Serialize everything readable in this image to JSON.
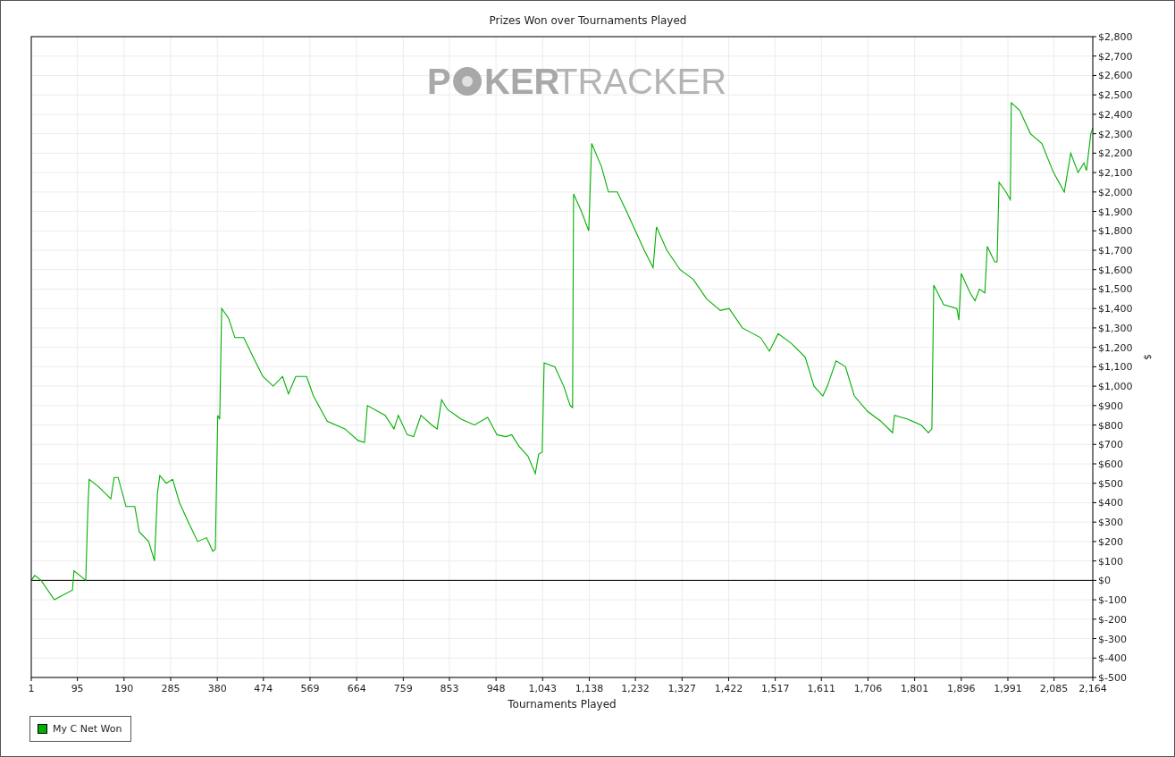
{
  "chart": {
    "watermark": {
      "lead": "P",
      "middle": "KER",
      "tail": "TRACKER"
    },
    "chart_data": {
      "type": "line",
      "grid": true,
      "title": "Prizes Won over Tournaments Played",
      "xlabel": "Tournaments Played",
      "ylabel": "$",
      "xlim": [
        1,
        2164
      ],
      "ylim": [
        -500,
        2800
      ],
      "xticks": [
        {
          "value": 1,
          "label": "1"
        },
        {
          "value": 95,
          "label": "95"
        },
        {
          "value": 190,
          "label": "190"
        },
        {
          "value": 285,
          "label": "285"
        },
        {
          "value": 380,
          "label": "380"
        },
        {
          "value": 474,
          "label": "474"
        },
        {
          "value": 569,
          "label": "569"
        },
        {
          "value": 664,
          "label": "664"
        },
        {
          "value": 759,
          "label": "759"
        },
        {
          "value": 853,
          "label": "853"
        },
        {
          "value": 948,
          "label": "948"
        },
        {
          "value": 1043,
          "label": "1,043"
        },
        {
          "value": 1138,
          "label": "1,138"
        },
        {
          "value": 1232,
          "label": "1,232"
        },
        {
          "value": 1327,
          "label": "1,327"
        },
        {
          "value": 1422,
          "label": "1,422"
        },
        {
          "value": 1517,
          "label": "1,517"
        },
        {
          "value": 1611,
          "label": "1,611"
        },
        {
          "value": 1706,
          "label": "1,706"
        },
        {
          "value": 1801,
          "label": "1,801"
        },
        {
          "value": 1896,
          "label": "1,896"
        },
        {
          "value": 1991,
          "label": "1,991"
        },
        {
          "value": 2085,
          "label": "2,085"
        },
        {
          "value": 2164,
          "label": "2,164"
        }
      ],
      "yticks": [
        {
          "value": 2800,
          "label": "$2,800"
        },
        {
          "value": 2700,
          "label": "$2,700"
        },
        {
          "value": 2600,
          "label": "$2,600"
        },
        {
          "value": 2500,
          "label": "$2,500"
        },
        {
          "value": 2400,
          "label": "$2,400"
        },
        {
          "value": 2300,
          "label": "$2,300"
        },
        {
          "value": 2200,
          "label": "$2,200"
        },
        {
          "value": 2100,
          "label": "$2,100"
        },
        {
          "value": 2000,
          "label": "$2,000"
        },
        {
          "value": 1900,
          "label": "$1,900"
        },
        {
          "value": 1800,
          "label": "$1,800"
        },
        {
          "value": 1700,
          "label": "$1,700"
        },
        {
          "value": 1600,
          "label": "$1,600"
        },
        {
          "value": 1500,
          "label": "$1,500"
        },
        {
          "value": 1400,
          "label": "$1,400"
        },
        {
          "value": 1300,
          "label": "$1,300"
        },
        {
          "value": 1200,
          "label": "$1,200"
        },
        {
          "value": 1100,
          "label": "$1,100"
        },
        {
          "value": 1000,
          "label": "$1,000"
        },
        {
          "value": 900,
          "label": "$900"
        },
        {
          "value": 800,
          "label": "$800"
        },
        {
          "value": 700,
          "label": "$700"
        },
        {
          "value": 600,
          "label": "$600"
        },
        {
          "value": 500,
          "label": "$500"
        },
        {
          "value": 400,
          "label": "$400"
        },
        {
          "value": 300,
          "label": "$300"
        },
        {
          "value": 200,
          "label": "$200"
        },
        {
          "value": 100,
          "label": "$100"
        },
        {
          "value": 0,
          "label": "$0"
        },
        {
          "value": -100,
          "label": "$-100"
        },
        {
          "value": -200,
          "label": "$-200"
        },
        {
          "value": -300,
          "label": "$-300"
        },
        {
          "value": -400,
          "label": "$-400"
        },
        {
          "value": -500,
          "label": "$-500"
        }
      ],
      "x": [
        1,
        8,
        21,
        48,
        85,
        88,
        112,
        116,
        119,
        139,
        163,
        170,
        178,
        194,
        212,
        221,
        240,
        252,
        258,
        263,
        276,
        289,
        303,
        321,
        340,
        358,
        371,
        376,
        381,
        385,
        389,
        403,
        416,
        434,
        453,
        473,
        494,
        513,
        525,
        540,
        562,
        576,
        604,
        640,
        667,
        680,
        686,
        722,
        740,
        749,
        767,
        780,
        795,
        817,
        828,
        837,
        849,
        877,
        904,
        931,
        950,
        968,
        980,
        995,
        1013,
        1028,
        1035,
        1042,
        1046,
        1068,
        1086,
        1099,
        1104,
        1106,
        1122,
        1137,
        1143,
        1163,
        1177,
        1195,
        1214,
        1232,
        1250,
        1268,
        1275,
        1296,
        1323,
        1350,
        1377,
        1405,
        1423,
        1450,
        1487,
        1505,
        1523,
        1550,
        1578,
        1596,
        1614,
        1623,
        1641,
        1660,
        1678,
        1705,
        1732,
        1756,
        1760,
        1787,
        1814,
        1829,
        1836,
        1840,
        1860,
        1887,
        1891,
        1896,
        1914,
        1924,
        1933,
        1944,
        1949,
        1964,
        1969,
        1973,
        1987,
        1996,
        1998,
        2015,
        2037,
        2060,
        2084,
        2106,
        2119,
        2134,
        2146,
        2151,
        2160,
        2164
      ],
      "series": [
        {
          "name": "My C Net Won",
          "color": "#00b000",
          "values": [
            0,
            25,
            0,
            -100,
            -50,
            50,
            0,
            350,
            520,
            480,
            420,
            530,
            530,
            380,
            380,
            250,
            200,
            100,
            450,
            540,
            500,
            520,
            400,
            300,
            200,
            220,
            150,
            160,
            850,
            830,
            1400,
            1350,
            1250,
            1250,
            1150,
            1050,
            1000,
            1050,
            960,
            1050,
            1050,
            950,
            820,
            780,
            720,
            710,
            900,
            850,
            780,
            850,
            750,
            740,
            850,
            800,
            780,
            930,
            880,
            830,
            800,
            840,
            750,
            740,
            750,
            690,
            640,
            550,
            650,
            660,
            1120,
            1100,
            1000,
            900,
            890,
            1990,
            1900,
            1800,
            2250,
            2130,
            2000,
            2000,
            1900,
            1800,
            1700,
            1610,
            1820,
            1700,
            1600,
            1550,
            1450,
            1390,
            1400,
            1300,
            1250,
            1180,
            1270,
            1220,
            1150,
            1000,
            950,
            1000,
            1130,
            1100,
            950,
            870,
            820,
            760,
            850,
            830,
            800,
            760,
            780,
            1520,
            1420,
            1400,
            1340,
            1580,
            1480,
            1440,
            1500,
            1480,
            1720,
            1640,
            1640,
            2050,
            2000,
            1960,
            2460,
            2420,
            2300,
            2250,
            2100,
            2000,
            2200,
            2100,
            2150,
            2110,
            2300,
            2330
          ]
        }
      ]
    }
  }
}
